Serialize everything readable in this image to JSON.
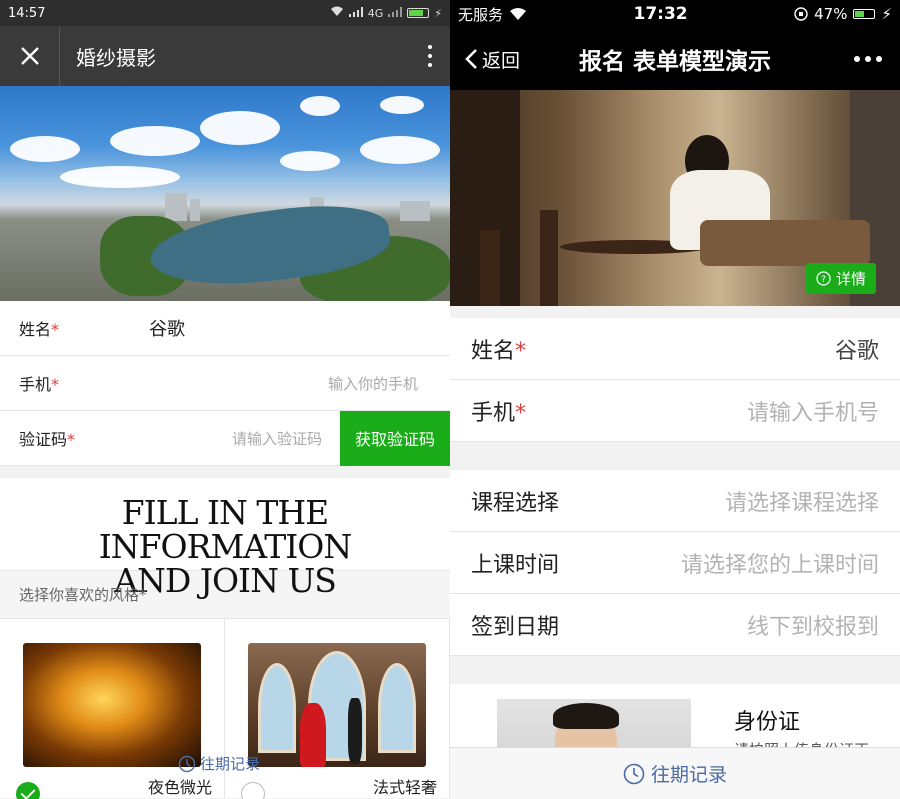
{
  "left": {
    "status": {
      "time": "14:57",
      "network": "4G"
    },
    "nav": {
      "title": "婚纱摄影"
    },
    "form": {
      "name_label": "姓名",
      "name_value": "谷歌",
      "phone_label": "手机",
      "phone_placeholder": "输入你的手机",
      "code_label": "验证码",
      "code_placeholder": "请输入验证码",
      "code_button": "获取验证码",
      "required_mark": "*"
    },
    "banner_text": {
      "line1": "FILL IN THE INFORMATION",
      "line2": "AND JOIN US"
    },
    "style_section": {
      "header": "选择你喜欢的风格",
      "required_mark": "*",
      "cards": [
        {
          "name": "夜色微光",
          "checked": true
        },
        {
          "name": "法式轻奢",
          "checked": false
        }
      ]
    },
    "history": "往期记录"
  },
  "right": {
    "status": {
      "carrier": "无服务",
      "time": "17:32",
      "battery": "47%"
    },
    "nav": {
      "back": "返回",
      "title": "报名 表单模型演示"
    },
    "detail_button": "详情",
    "group1": [
      {
        "label": "姓名",
        "required": true,
        "value": "谷歌",
        "placeholder": ""
      },
      {
        "label": "手机",
        "required": true,
        "value": "",
        "placeholder": "请输入手机号"
      }
    ],
    "group2": [
      {
        "label": "课程选择",
        "placeholder": "请选择课程选择"
      },
      {
        "label": "上课时间",
        "placeholder": "请选择您的上课时间"
      },
      {
        "label": "签到日期",
        "placeholder": "线下到校报到"
      }
    ],
    "id_card": {
      "title": "身份证",
      "subtitle": "请拍照上传身份证正"
    },
    "history": "往期记录",
    "required_mark": "*"
  }
}
